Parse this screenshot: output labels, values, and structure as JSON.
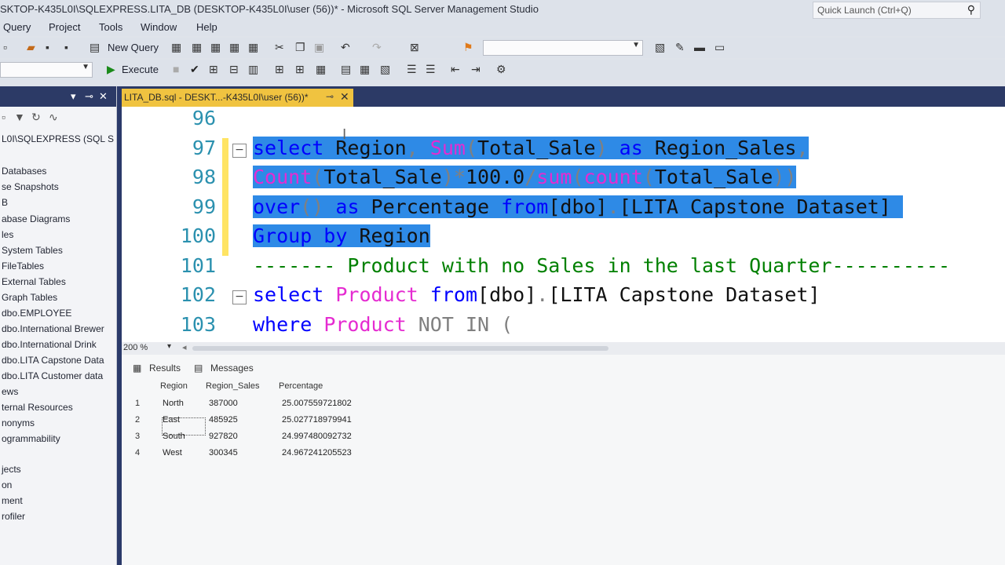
{
  "window": {
    "title": "SKTOP-K435L0I\\SQLEXPRESS.LITA_DB (DESKTOP-K435L0I\\user (56))* - Microsoft SQL Server Management Studio",
    "quick_launch": "Quick Launch (Ctrl+Q)"
  },
  "menu": [
    "Query",
    "Project",
    "Tools",
    "Window",
    "Help"
  ],
  "toolbar": {
    "new_query": "New Query",
    "execute": "Execute"
  },
  "object_explorer": {
    "server": "L0I\\SQLEXPRESS (SQL S",
    "items": [
      "Databases",
      "se Snapshots",
      "B",
      "abase Diagrams",
      "les",
      "System Tables",
      "FileTables",
      "External Tables",
      "Graph Tables",
      "dbo.EMPLOYEE",
      "dbo.International Brewer",
      "dbo.International Drink",
      "dbo.LITA Capstone Data",
      "dbo.LITA Customer data",
      "ews",
      "ternal Resources",
      "nonyms",
      "ogrammability",
      "jects",
      "on",
      "ment",
      "rofiler"
    ]
  },
  "doc_tab": {
    "label": "LITA_DB.sql - DESKT...-K435L0I\\user (56))*",
    "pin": "⊸",
    "close": "✕"
  },
  "editor": {
    "zoom": "200 %",
    "lines": [
      {
        "num": "96",
        "segments": []
      },
      {
        "num": "97",
        "fold": "−",
        "segments": [
          {
            "t": "select",
            "c": "kw",
            "hl": true
          },
          {
            "t": " Region",
            "c": "plain",
            "hl": true
          },
          {
            "t": ",",
            "c": "gr",
            "hl": true
          },
          {
            "t": " ",
            "c": "plain",
            "hl": true
          },
          {
            "t": "Sum",
            "c": "fn",
            "hl": true
          },
          {
            "t": "(",
            "c": "gr",
            "hl": true
          },
          {
            "t": "Total_Sale",
            "c": "plain",
            "hl": true
          },
          {
            "t": ")",
            "c": "gr",
            "hl": true
          },
          {
            "t": " ",
            "c": "plain",
            "hl": true
          },
          {
            "t": "as",
            "c": "kw",
            "hl": true
          },
          {
            "t": " Region_Sales",
            "c": "plain",
            "hl": true
          },
          {
            "t": ",",
            "c": "gr",
            "hl": true
          }
        ]
      },
      {
        "num": "98",
        "segments": [
          {
            "t": "Count",
            "c": "fn",
            "hl": true
          },
          {
            "t": "(",
            "c": "gr",
            "hl": true
          },
          {
            "t": "Total_Sale",
            "c": "plain",
            "hl": true
          },
          {
            "t": ")",
            "c": "gr",
            "hl": true
          },
          {
            "t": "*",
            "c": "gr",
            "hl": true
          },
          {
            "t": "100.0",
            "c": "plain",
            "hl": true
          },
          {
            "t": "/",
            "c": "gr",
            "hl": true
          },
          {
            "t": "sum",
            "c": "fn",
            "hl": true
          },
          {
            "t": "(",
            "c": "gr",
            "hl": true
          },
          {
            "t": "count",
            "c": "fn",
            "hl": true
          },
          {
            "t": "(",
            "c": "gr",
            "hl": true
          },
          {
            "t": "Total_Sale",
            "c": "plain",
            "hl": true
          },
          {
            "t": "))",
            "c": "gr",
            "hl": true
          }
        ]
      },
      {
        "num": "99",
        "segments": [
          {
            "t": "over",
            "c": "kw",
            "hl": true
          },
          {
            "t": "()",
            "c": "gr",
            "hl": true
          },
          {
            "t": " ",
            "c": "plain",
            "hl": true
          },
          {
            "t": "as",
            "c": "kw",
            "hl": true
          },
          {
            "t": " Percentage ",
            "c": "plain",
            "hl": true
          },
          {
            "t": "from",
            "c": "kw",
            "hl": true
          },
          {
            "t": "[dbo]",
            "c": "plain",
            "hl": true
          },
          {
            "t": ".",
            "c": "gr",
            "hl": true
          },
          {
            "t": "[LITA Capstone Dataset] ",
            "c": "plain",
            "hl": true
          }
        ]
      },
      {
        "num": "100",
        "segments": [
          {
            "t": "Group by",
            "c": "kw",
            "hl": true
          },
          {
            "t": " Region",
            "c": "plain",
            "hl": true
          }
        ]
      },
      {
        "num": "101",
        "segments": [
          {
            "t": "------- Product with no Sales in the last Quarter----------",
            "c": "cm",
            "hl": false
          }
        ]
      },
      {
        "num": "102",
        "fold": "−",
        "segments": [
          {
            "t": "select",
            "c": "kw",
            "hl": false
          },
          {
            "t": " ",
            "c": "plain",
            "hl": false
          },
          {
            "t": "Product",
            "c": "fn",
            "hl": false
          },
          {
            "t": " ",
            "c": "plain",
            "hl": false
          },
          {
            "t": "from",
            "c": "kw",
            "hl": false
          },
          {
            "t": "[dbo]",
            "c": "plain",
            "hl": false
          },
          {
            "t": ".",
            "c": "gr",
            "hl": false
          },
          {
            "t": "[LITA Capstone Dataset]",
            "c": "plain",
            "hl": false
          }
        ]
      },
      {
        "num": "103",
        "segments": [
          {
            "t": "where",
            "c": "kw",
            "hl": false
          },
          {
            "t": " ",
            "c": "plain",
            "hl": false
          },
          {
            "t": "Product",
            "c": "fn",
            "hl": false
          },
          {
            "t": " ",
            "c": "plain",
            "hl": false
          },
          {
            "t": "NOT IN",
            "c": "gr",
            "hl": false
          },
          {
            "t": " (",
            "c": "gr",
            "hl": false
          }
        ]
      }
    ]
  },
  "results": {
    "tabs": [
      "Results",
      "Messages"
    ],
    "columns": [
      "Region",
      "Region_Sales",
      "Percentage"
    ],
    "rows": [
      {
        "n": "1",
        "cells": [
          "North",
          "387000",
          "25.007559721802"
        ]
      },
      {
        "n": "2",
        "cells": [
          "East",
          "485925",
          "25.027718979941"
        ]
      },
      {
        "n": "3",
        "cells": [
          "South",
          "927820",
          "24.997480092732"
        ]
      },
      {
        "n": "4",
        "cells": [
          "West",
          "300345",
          "24.967241205523"
        ]
      }
    ]
  },
  "colors": {
    "selection": "#2e8ae6",
    "keyword": "#0000ff",
    "function": "#e52bd1",
    "comment": "#008000",
    "line_number": "#2b91af",
    "tab_active": "#f0c340",
    "chrome_dark": "#2c3a66"
  }
}
